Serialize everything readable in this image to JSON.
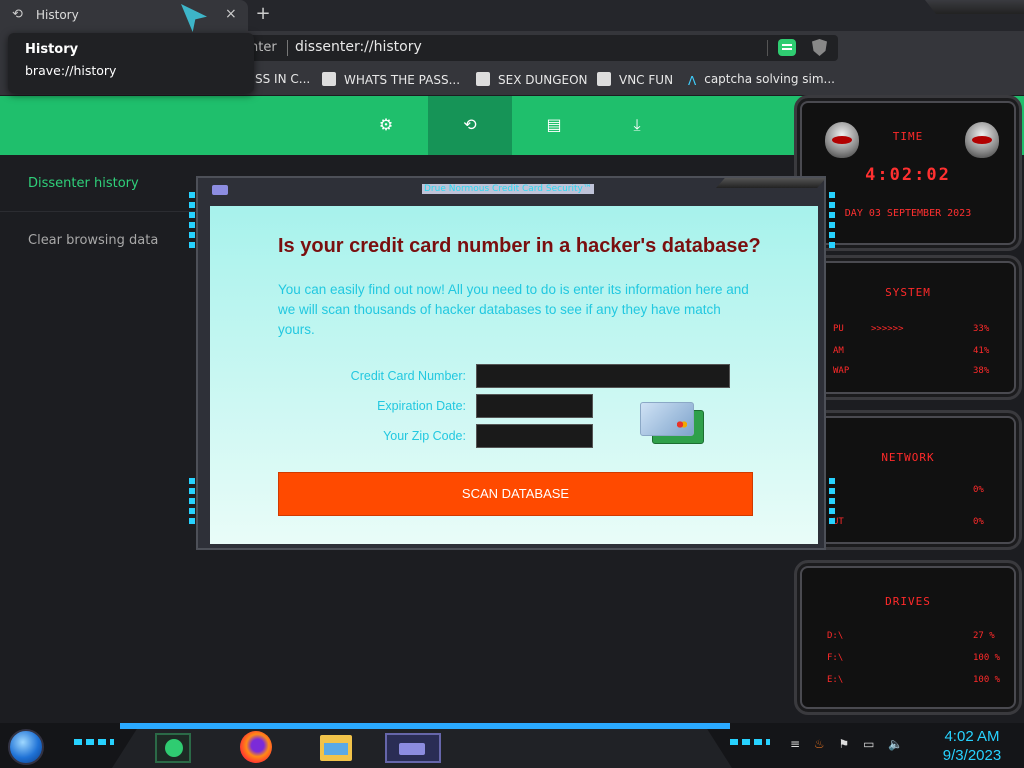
{
  "browser": {
    "tab": {
      "title": "History",
      "close": "×"
    },
    "newtab": "+",
    "address": {
      "prefix": "nter",
      "url": "dissenter://history"
    },
    "history_popup": {
      "title": "History",
      "subtitle": "brave://history"
    },
    "bookmarks": [
      {
        "label": "SS IN C..."
      },
      {
        "label": "WHATS THE PASS..."
      },
      {
        "label": "SEX DUNGEON"
      },
      {
        "label": "VNC FUN"
      },
      {
        "label": "captcha solving sim..."
      }
    ],
    "menu": "⋮"
  },
  "page": {
    "toolbar_icons": [
      "settings-icon",
      "history-icon",
      "bookmarks-icon",
      "downloads-icon"
    ],
    "sidebar": [
      {
        "label": "Dissenter history"
      },
      {
        "label": "Clear browsing data"
      }
    ],
    "colors": {
      "accent": "#1fbf6c",
      "accent_dark": "#169457",
      "link": "#2fd07a"
    }
  },
  "popup": {
    "window_title": "Drue Normous Credit Card Security™",
    "heading": "Is your credit card number in a hacker's database?",
    "description": "You can easily find out now! All you need to do is enter its information here and we will scan thousands of hacker databases to see if any they have match yours.",
    "fields": [
      {
        "label": "Credit Card Number:",
        "value": ""
      },
      {
        "label": "Expiration Date:",
        "value": ""
      },
      {
        "label": "Your Zip Code:",
        "value": ""
      }
    ],
    "button": "SCAN DATABASE",
    "colors": {
      "heading": "#7a0f0f",
      "text": "#22c8e0",
      "button": "#ff4a00"
    }
  },
  "gadgets": {
    "time": {
      "title": "TIME",
      "clock": "4:02:02",
      "date": "DAY 03 SEPTEMBER 2023"
    },
    "system": {
      "title": "SYSTEM",
      "rows": [
        {
          "label": "PU",
          "value": "33%"
        },
        {
          "label": "AM",
          "value": "41%"
        },
        {
          "label": "WAP",
          "value": "38%"
        }
      ]
    },
    "network": {
      "title": "NETWORK",
      "rows": [
        {
          "label": "",
          "value": "0%"
        },
        {
          "label": "UT",
          "value": "0%"
        }
      ]
    },
    "drives": {
      "title": "DRIVES",
      "rows": [
        {
          "label": "D:\\",
          "value": "27 %"
        },
        {
          "label": "F:\\",
          "value": "100 %"
        },
        {
          "label": "E:\\",
          "value": "100 %"
        }
      ]
    }
  },
  "taskbar": {
    "time": "4:02 AM",
    "date": "9/3/2023"
  }
}
